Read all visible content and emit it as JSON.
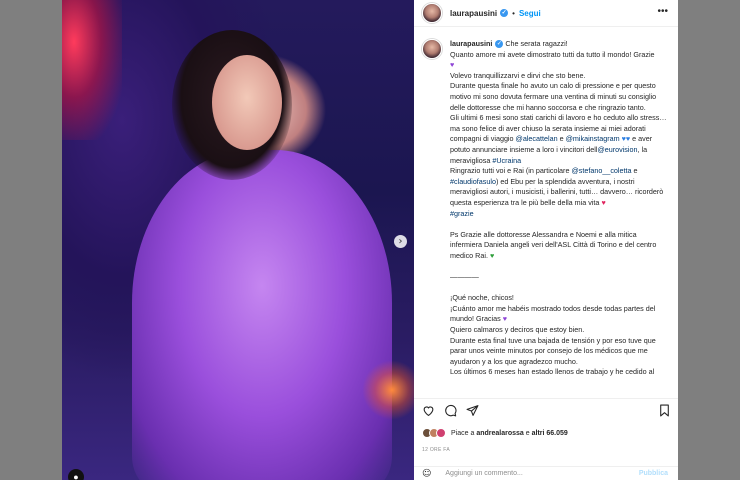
{
  "header": {
    "username": "laurapausini",
    "follow_label": "Segui",
    "more_label": "•••"
  },
  "caption": {
    "username": "laurapausini",
    "lines": [
      "Che serata ragazzi!",
      "Quanto amore mi avete dimostrato tutti da tutto il mondo! Grazie",
      "",
      "Volevo tranquillizzarvi e dirvi che sto bene.",
      "Durante questa finale ho avuto un calo di pressione e per questo motivo mi sono dovuta fermare una ventina di minuti su consiglio delle dottoresse che mi hanno soccorsa e che ringrazio tanto.",
      "Gli ultimi 6 mesi sono stati carichi di lavoro e ho ceduto allo stress… ma sono felice di aver chiuso la serata insieme ai miei adorati compagni di viaggio",
      "@alecattelan",
      "e",
      "@mikainstagram",
      "e aver potuto annunciare insieme a loro i vincitori dell",
      "@eurovision",
      ", la meravigliosa",
      "#Ucraina",
      "Ringrazio tutti voi e Rai (in particolare",
      "@stefano__coletta",
      "e",
      "#claudiofasulo",
      ") ed Ebu per la splendida avventura, i nostri meravigliosi autori, i musicisti, i ballerini, tutti… davvero… ricorderò questa esperienza tra le più belle della mia vita",
      "#grazie",
      "Ps Grazie alle dottoresse Alessandra e Noemi e alla mitica infermiera Daniela angeli veri dell'ASL Città di Torino e del centro medico Rai.",
      "————",
      "¡Qué noche, chicos!",
      "¡Cuánto amor me habéis mostrado todos desde todas partes del mundo! Gracias",
      "Quiero calmaros y deciros que estoy bien.",
      "Durante esta final tuve una bajada de tensión y por eso tuve que parar unos veinte minutos por consejo de los médicos que me ayudaron y a los que agradezco mucho.",
      "Los últimos 6 meses han estado llenos de trabajo y he cedido al"
    ]
  },
  "likes": {
    "prefix": "Piace a",
    "user": "andrealarossa",
    "middle": "e",
    "others": "altri 66.059"
  },
  "date": "12 ORE FA",
  "comment": {
    "placeholder": "Aggiungi un commento...",
    "publish_label": "Pubblica"
  },
  "icons": {
    "like": "heart-outline-icon",
    "comment": "comment-icon",
    "share": "share-icon",
    "save": "bookmark-icon",
    "next": "chevron-right-icon",
    "emoji": "smiley-icon",
    "tag": "user-tag-icon"
  },
  "colors": {
    "accent": "#0095f6",
    "link": "#00376b",
    "verified": "#3897f0"
  }
}
